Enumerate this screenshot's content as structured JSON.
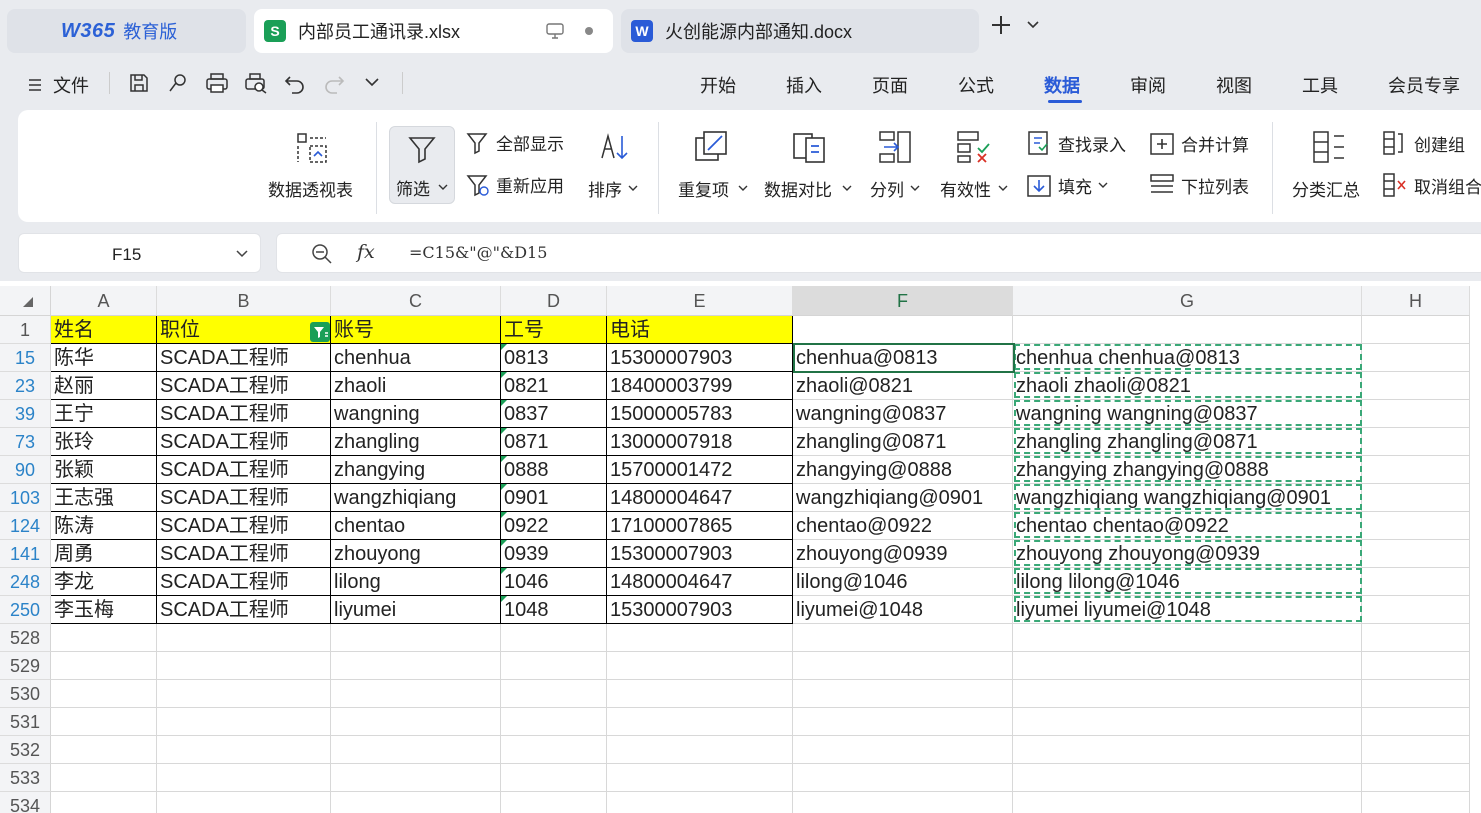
{
  "tabs": {
    "home_logo": "W365",
    "home_label": "教育版",
    "xlsx": {
      "icon": "S",
      "name": "内部员工通讯录.xlsx",
      "color": "#1a9f57"
    },
    "docx": {
      "icon": "W",
      "name": "火创能源内部通知.docx",
      "color": "#2a5bd7"
    }
  },
  "menu": {
    "file": "文件",
    "tabs": [
      "开始",
      "插入",
      "页面",
      "公式",
      "数据",
      "审阅",
      "视图",
      "工具",
      "会员专享"
    ],
    "active": "数据"
  },
  "ribbon": {
    "pivot": "数据透视表",
    "filter": "筛选",
    "show_all": "全部显示",
    "reapply": "重新应用",
    "sort": "排序",
    "duplicates": "重复项",
    "compare": "数据对比",
    "split": "分列",
    "validity": "有效性",
    "lookup_entry": "查找录入",
    "fill": "填充",
    "consolidate": "合并计算",
    "dropdown_list": "下拉列表",
    "subtotal": "分类汇总",
    "create_group": "创建组",
    "ungroup": "取消组合"
  },
  "formula_bar": {
    "cell_ref": "F15",
    "fx": "fx",
    "formula": "=C15&\"@\"&D15"
  },
  "sheet": {
    "columns": [
      "A",
      "B",
      "C",
      "D",
      "E",
      "F",
      "G",
      "H"
    ],
    "selected_column": "F",
    "header_row": {
      "row": "1",
      "cells": [
        "姓名",
        "职位",
        "账号",
        "工号",
        "电话",
        "",
        ""
      ]
    },
    "rows": [
      {
        "row": "15",
        "cells": [
          "陈华",
          "SCADA工程师",
          "chenhua",
          "0813",
          "15300007903",
          "chenhua@0813",
          "chenhua chenhua@0813"
        ]
      },
      {
        "row": "23",
        "cells": [
          "赵丽",
          "SCADA工程师",
          "zhaoli",
          "0821",
          "18400003799",
          "zhaoli@0821",
          "zhaoli zhaoli@0821"
        ]
      },
      {
        "row": "39",
        "cells": [
          "王宁",
          "SCADA工程师",
          "wangning",
          "0837",
          "15000005783",
          "wangning@0837",
          "wangning wangning@0837"
        ]
      },
      {
        "row": "73",
        "cells": [
          "张玲",
          "SCADA工程师",
          "zhangling",
          "0871",
          "13000007918",
          "zhangling@0871",
          "zhangling zhangling@0871"
        ]
      },
      {
        "row": "90",
        "cells": [
          "张颖",
          "SCADA工程师",
          "zhangying",
          "0888",
          "15700001472",
          "zhangying@0888",
          "zhangying zhangying@0888"
        ]
      },
      {
        "row": "103",
        "cells": [
          "王志强",
          "SCADA工程师",
          "wangzhiqiang",
          "0901",
          "14800004647",
          "wangzhiqiang@0901",
          "wangzhiqiang wangzhiqiang@0901"
        ]
      },
      {
        "row": "124",
        "cells": [
          "陈涛",
          "SCADA工程师",
          "chentao",
          "0922",
          "17100007865",
          "chentao@0922",
          "chentao chentao@0922"
        ]
      },
      {
        "row": "141",
        "cells": [
          "周勇",
          "SCADA工程师",
          "zhouyong",
          "0939",
          "15300007903",
          "zhouyong@0939",
          "zhouyong zhouyong@0939"
        ]
      },
      {
        "row": "248",
        "cells": [
          "李龙",
          "SCADA工程师",
          "lilong",
          "1046",
          "14800004647",
          "lilong@1046",
          "lilong lilong@1046"
        ]
      },
      {
        "row": "250",
        "cells": [
          "李玉梅",
          "SCADA工程师",
          "liyumei",
          "1048",
          "15300007903",
          "liyumei@1048",
          "liyumei liyumei@1048"
        ]
      }
    ],
    "empty_rows": [
      "528",
      "529",
      "530",
      "531",
      "532",
      "533",
      "534"
    ]
  }
}
